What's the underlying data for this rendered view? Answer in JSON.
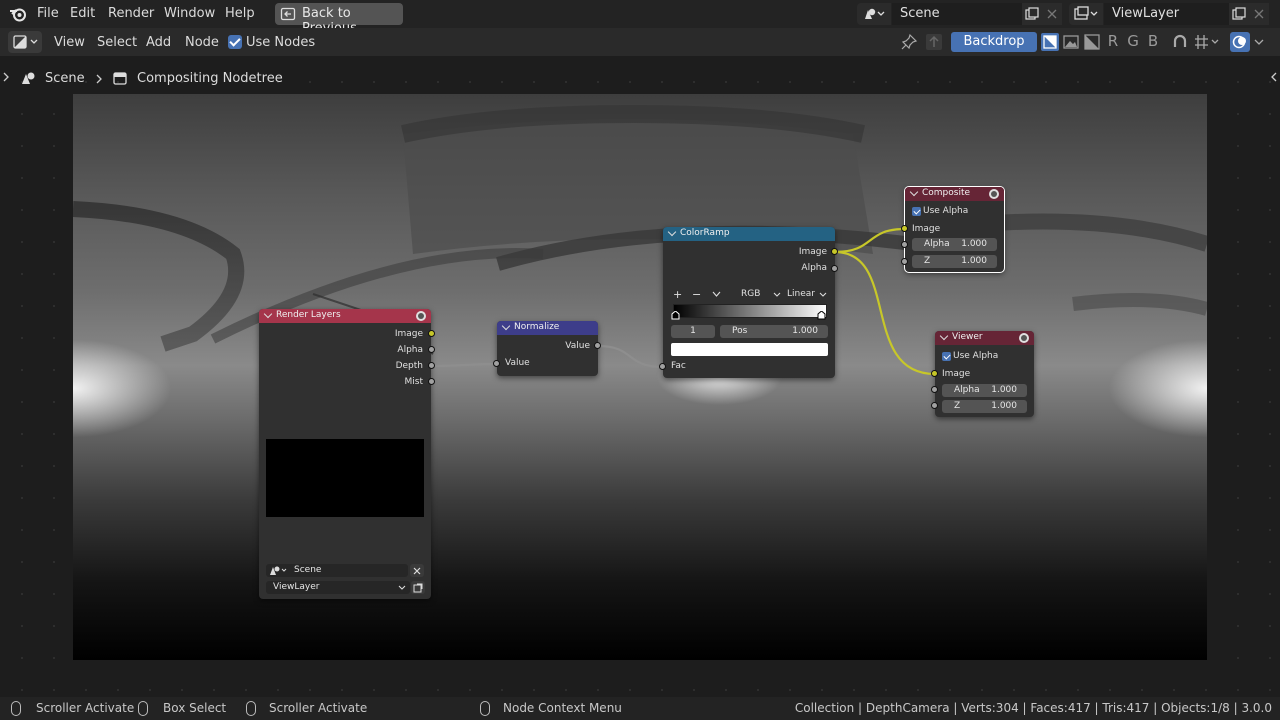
{
  "topbar": {
    "menus": [
      "File",
      "Edit",
      "Render",
      "Window",
      "Help"
    ],
    "back_button": "Back to Previous",
    "scene_field": "Scene",
    "viewlayer_field": "ViewLayer"
  },
  "header": {
    "menus": [
      "View",
      "Select",
      "Add",
      "Node"
    ],
    "use_nodes_label": "Use Nodes",
    "backdrop_label": "Backdrop",
    "channels": [
      "R",
      "G",
      "B"
    ]
  },
  "breadcrumb": {
    "scene": "Scene",
    "tree": "Compositing Nodetree"
  },
  "nodes": {
    "render_layers": {
      "title": "Render Layers",
      "color": "#a5354b",
      "outputs": [
        "Image",
        "Alpha",
        "Depth",
        "Mist"
      ],
      "scene": "Scene",
      "view_layer": "ViewLayer"
    },
    "normalize": {
      "title": "Normalize",
      "color": "#3d3d8a",
      "output": "Value",
      "input": "Value"
    },
    "color_ramp": {
      "title": "ColorRamp",
      "color": "#246283",
      "outputs": [
        "Image",
        "Alpha"
      ],
      "add": "+",
      "remove": "−",
      "color_mode": "RGB",
      "interpolation": "Linear",
      "active_stop": "1",
      "pos_label": "Pos",
      "pos_value": "1.000",
      "input": "Fac"
    },
    "composite": {
      "title": "Composite",
      "color": "#662536",
      "use_alpha": "Use Alpha",
      "input_image": "Image",
      "alpha_label": "Alpha",
      "alpha_value": "1.000",
      "z_label": "Z",
      "z_value": "1.000"
    },
    "viewer": {
      "title": "Viewer",
      "color": "#662536",
      "use_alpha": "Use Alpha",
      "input_image": "Image",
      "alpha_label": "Alpha",
      "alpha_value": "1.000",
      "z_label": "Z",
      "z_value": "1.000"
    }
  },
  "statusbar": {
    "items": [
      "Scroller Activate",
      "Box Select",
      "Scroller Activate",
      "Node Context Menu"
    ],
    "info": "Collection | DepthCamera | Verts:304 | Faces:417 | Tris:417 | Objects:1/8 | 3.0.0"
  },
  "colors": {
    "accent": "#4772b3",
    "link_yellow": "#c7c729",
    "link_grey": "#a1a1a1"
  }
}
